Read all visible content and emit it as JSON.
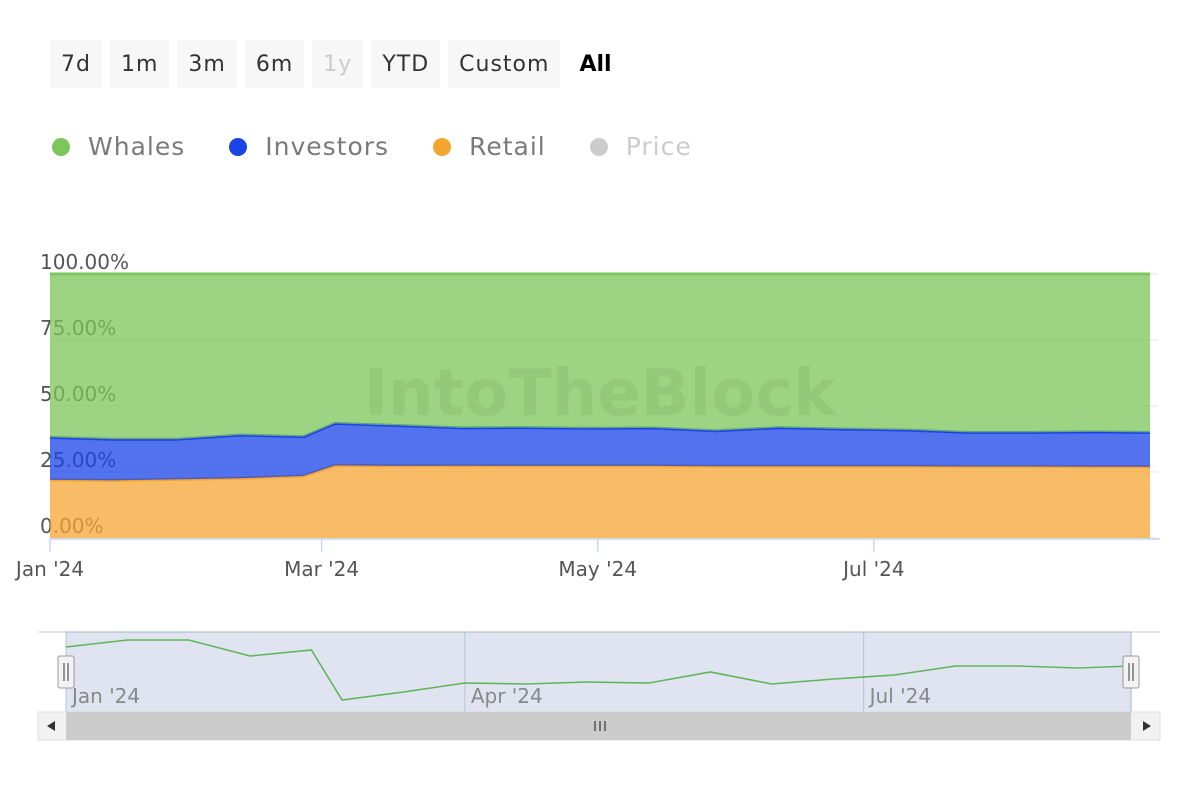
{
  "range_selector": {
    "buttons": [
      "7d",
      "1m",
      "3m",
      "6m",
      "1y",
      "YTD",
      "Custom"
    ],
    "disabled": [
      "1y"
    ],
    "active_label": "All"
  },
  "legend": [
    {
      "label": "Whales",
      "color": "#7cc65a",
      "visible": true
    },
    {
      "label": "Investors",
      "color": "#1a43e8",
      "visible": true
    },
    {
      "label": "Retail",
      "color": "#f4a531",
      "visible": true
    },
    {
      "label": "Price",
      "color": "#cccccc",
      "visible": false
    }
  ],
  "watermark": "IntoTheBlock",
  "chart_data": {
    "type": "area",
    "stacked": true,
    "percent": true,
    "ylim": [
      0,
      100
    ],
    "y_ticks": [
      "0.00%",
      "25.00%",
      "50.00%",
      "75.00%",
      "100.00%"
    ],
    "x_ticks": [
      "Jan '24",
      "Mar '24",
      "May '24",
      "Jul '24"
    ],
    "x": [
      "2024-01-01",
      "2024-01-15",
      "2024-01-29",
      "2024-02-12",
      "2024-02-26",
      "2024-03-04",
      "2024-03-18",
      "2024-04-01",
      "2024-04-15",
      "2024-04-29",
      "2024-05-13",
      "2024-05-27",
      "2024-06-10",
      "2024-06-24",
      "2024-07-08",
      "2024-07-22",
      "2024-08-05",
      "2024-08-19",
      "2024-08-31"
    ],
    "series": [
      {
        "name": "Retail",
        "color": "#f4a531",
        "values": [
          22.0,
          21.8,
          22.2,
          22.6,
          23.5,
          27.5,
          27.3,
          27.4,
          27.3,
          27.3,
          27.3,
          27.2,
          27.2,
          27.2,
          27.2,
          27.1,
          27.1,
          27.0,
          27.0
        ]
      },
      {
        "name": "Investors",
        "color": "#1a43e8",
        "values": [
          16.1,
          15.6,
          15.2,
          16.4,
          14.9,
          15.9,
          15.3,
          14.3,
          14.5,
          14.3,
          14.4,
          13.4,
          14.6,
          14.1,
          13.7,
          12.9,
          12.9,
          13.2,
          13.0
        ]
      },
      {
        "name": "Whales",
        "color": "#7cc65a",
        "values": [
          61.9,
          62.6,
          62.6,
          61.0,
          61.6,
          56.6,
          57.4,
          58.3,
          58.2,
          58.4,
          58.3,
          59.4,
          58.2,
          58.7,
          59.1,
          60.0,
          60.0,
          59.8,
          60.0
        ]
      }
    ],
    "navigator": {
      "x_ticks": [
        "Jan '24",
        "Apr '24",
        "Jul '24"
      ]
    }
  }
}
